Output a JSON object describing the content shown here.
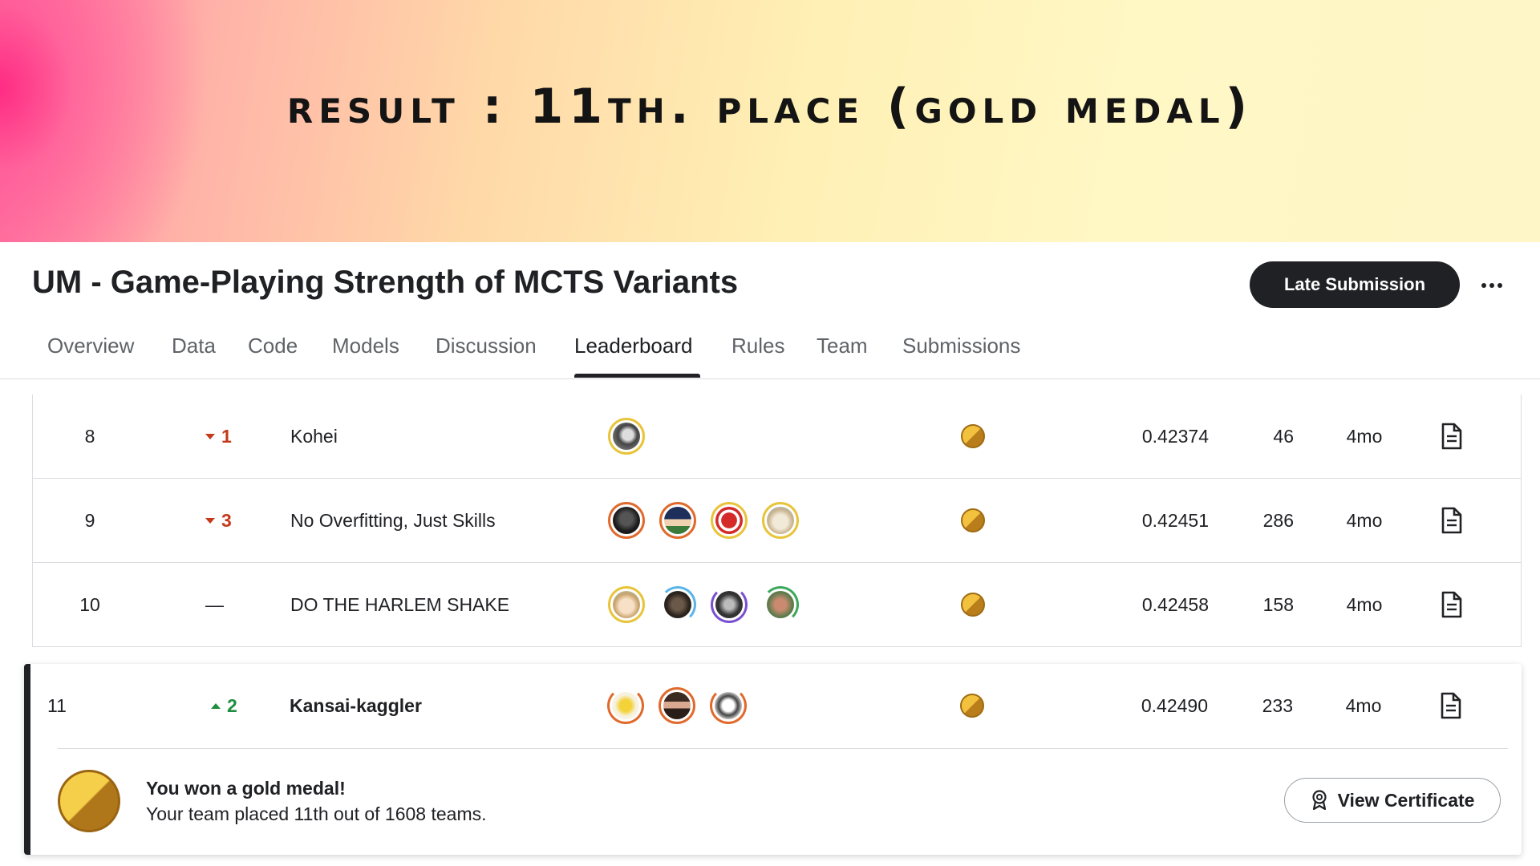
{
  "banner": {
    "title": "result : 11th. place (gold medal)"
  },
  "header": {
    "competition_title": "UM - Game-Playing Strength of MCTS Variants",
    "late_submission_label": "Late Submission",
    "more_icon": "more-horizontal-icon"
  },
  "tabs": [
    {
      "label": "Overview"
    },
    {
      "label": "Data"
    },
    {
      "label": "Code"
    },
    {
      "label": "Models"
    },
    {
      "label": "Discussion"
    },
    {
      "label": "Leaderboard",
      "active": true
    },
    {
      "label": "Rules"
    },
    {
      "label": "Team"
    },
    {
      "label": "Submissions"
    }
  ],
  "leaderboard": {
    "rows": [
      {
        "rank": "8",
        "delta": "1",
        "delta_dir": "down",
        "team": "Kohei",
        "avatars": 1,
        "medal": "gold",
        "score": "0.42374",
        "entries": "46",
        "last": "4mo"
      },
      {
        "rank": "9",
        "delta": "3",
        "delta_dir": "down",
        "team": "No Overfitting, Just Skills",
        "avatars": 4,
        "medal": "gold",
        "score": "0.42451",
        "entries": "286",
        "last": "4mo"
      },
      {
        "rank": "10",
        "delta": "—",
        "delta_dir": "none",
        "team": "DO THE HARLEM SHAKE",
        "avatars": 4,
        "medal": "gold",
        "score": "0.42458",
        "entries": "158",
        "last": "4mo"
      }
    ],
    "my_row": {
      "rank": "11",
      "delta": "2",
      "delta_dir": "up",
      "team": "Kansai-kaggler",
      "avatars": 3,
      "medal": "gold",
      "score": "0.42490",
      "entries": "233",
      "last": "4mo"
    }
  },
  "medal_banner": {
    "title": "You won a gold medal!",
    "subtitle": "Your team placed 11th out of 1608 teams.",
    "button_label": "View Certificate"
  },
  "colors": {
    "gold": "#f2c23f",
    "gold_dark": "#b97d1b",
    "down": "#c5391a",
    "up": "#1e8e3e",
    "button_dark": "#202124"
  }
}
